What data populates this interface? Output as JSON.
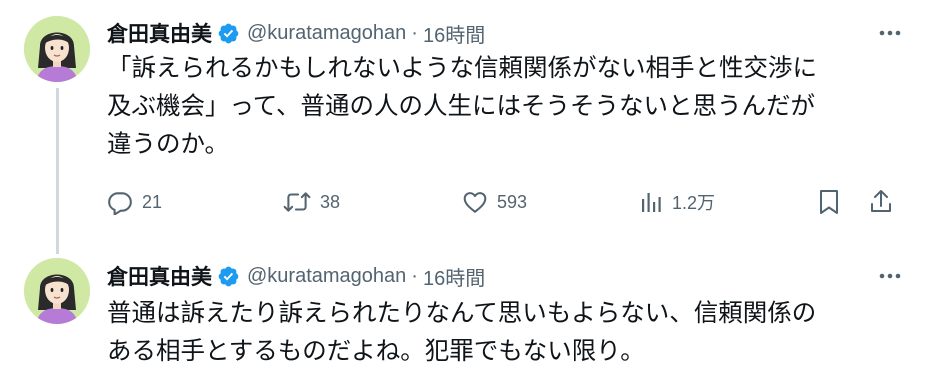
{
  "tweets": [
    {
      "author": {
        "display_name": "倉田真由美",
        "handle": "@kuratamagohan",
        "verified": true
      },
      "separator": "·",
      "timestamp": "16時間",
      "text_lines": [
        "「訴えられるかもしれないような信頼関係がない相手と性交渉に",
        "及ぶ機会」って、普通の人の人生にはそうそうないと思うんだが",
        "違うのか。"
      ],
      "stats": {
        "replies": "21",
        "retweets": "38",
        "likes": "593",
        "views": "1.2万"
      }
    },
    {
      "author": {
        "display_name": "倉田真由美",
        "handle": "@kuratamagohan",
        "verified": true
      },
      "separator": "·",
      "timestamp": "16時間",
      "text_lines": [
        "普通は訴えたり訴えられたりなんて思いもよらない、信頼関係の",
        "ある相手とするものだよね。犯罪でもない限り。"
      ]
    }
  ],
  "colors": {
    "text_primary": "#0f1419",
    "text_secondary": "#536471",
    "verified_blue": "#1d9bf0",
    "avatar_bg": "#cfe9a5",
    "thread_line": "#cfd9de"
  },
  "icons": {
    "verified": "verified-badge-icon",
    "more": "more-horizontal-icon",
    "reply": "reply-bubble-icon",
    "retweet": "retweet-arrows-icon",
    "like": "heart-icon",
    "views": "bar-chart-icon",
    "bookmark": "bookmark-icon",
    "share": "share-upload-icon"
  }
}
